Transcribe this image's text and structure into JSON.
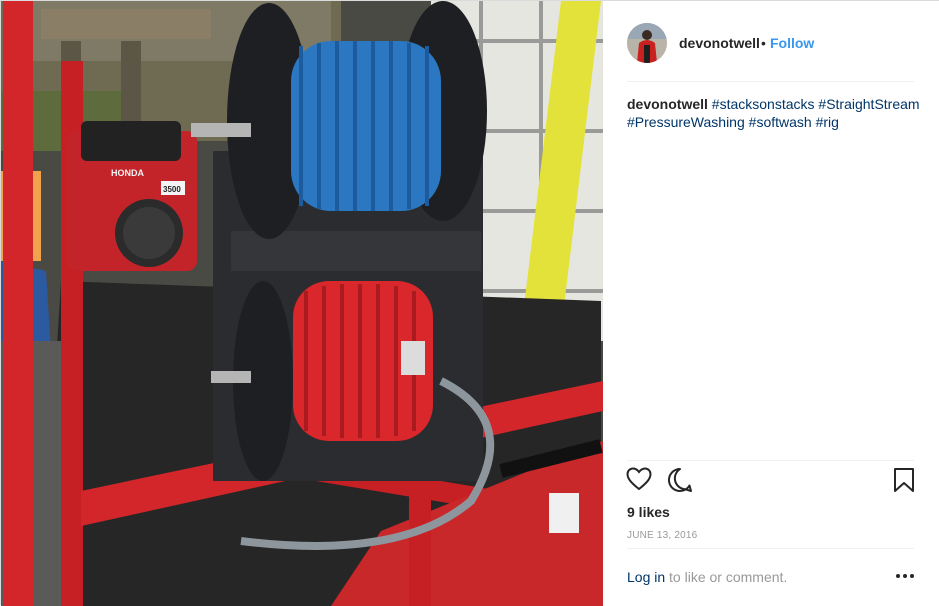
{
  "post": {
    "username": "devonotwell",
    "separator": "•",
    "follow_label": "Follow",
    "caption": {
      "username": "devonotwell",
      "hashtags": [
        "#stacksonstacks",
        "#StraightStream",
        "#PressureWashing",
        "#softwash",
        "#rig"
      ]
    },
    "likes": "9 likes",
    "date": "JUNE 13, 2016",
    "login_link": "Log in",
    "login_suffix": " to like or comment.",
    "more_options": "•••"
  },
  "icons": {
    "like": "heart-icon",
    "comment": "comment-icon",
    "save": "bookmark-icon",
    "more": "more-options-icon"
  },
  "photo": {
    "engine_label_brand": "HONDA",
    "engine_label_model": "3500"
  },
  "colors": {
    "link_blue": "#3897f0",
    "hashtag_navy": "#003569",
    "muted_gray": "#999999",
    "text_dark": "#262626"
  }
}
